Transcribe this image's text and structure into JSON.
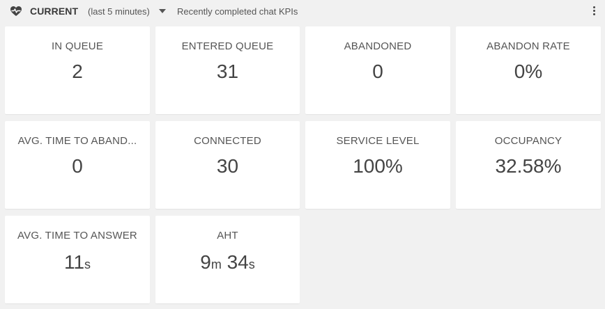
{
  "header": {
    "title": "CURRENT",
    "range": "(last 5 minutes)",
    "subtitle": "Recently completed chat KPIs",
    "icons": {
      "status": "heart-pulse-icon",
      "dropdown": "caret-down-icon",
      "menu": "vertical-dots-icon"
    }
  },
  "tiles": [
    {
      "label": "IN QUEUE",
      "value": "2"
    },
    {
      "label": "ENTERED QUEUE",
      "value": "31"
    },
    {
      "label": "ABANDONED",
      "value": "0"
    },
    {
      "label": "ABANDON RATE",
      "value": "0%"
    },
    {
      "label": "AVG. TIME TO ABAND...",
      "value": "0"
    },
    {
      "label": "CONNECTED",
      "value": "30"
    },
    {
      "label": "SERVICE LEVEL",
      "value": "100%"
    },
    {
      "label": "OCCUPANCY",
      "value": "32.58%"
    },
    {
      "label": "AVG. TIME TO ANSWER",
      "value_num": "11",
      "value_unit": "s"
    },
    {
      "label": "AHT",
      "value_min": "9",
      "unit_min": "m",
      "value_sec": "34",
      "unit_sec": "s"
    }
  ]
}
